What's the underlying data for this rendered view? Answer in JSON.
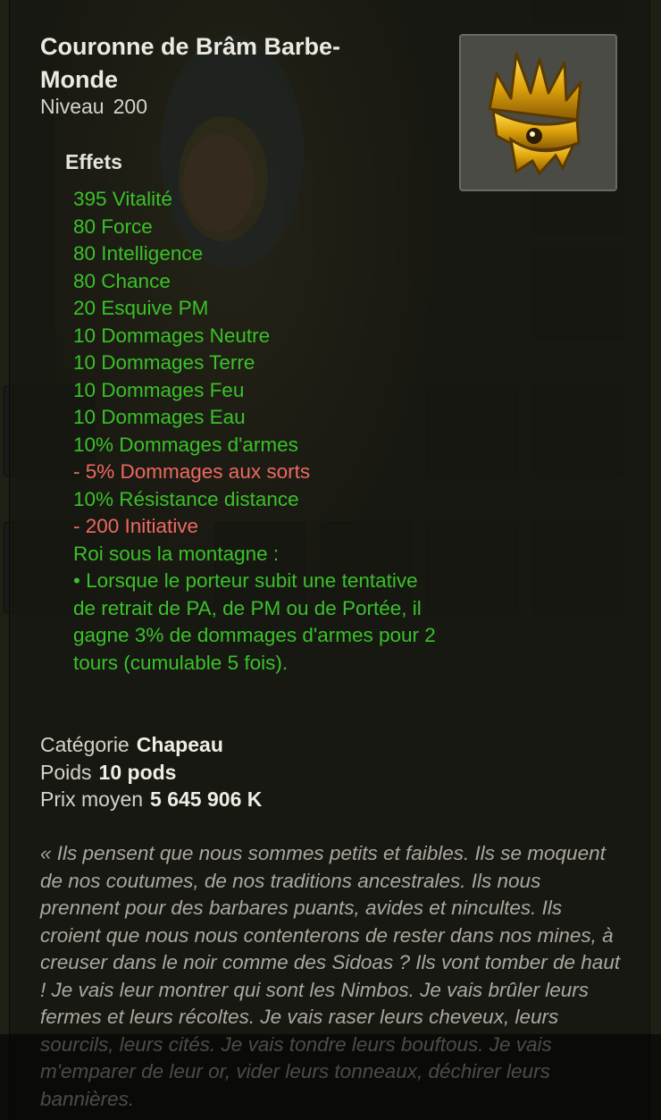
{
  "item": {
    "name": "Couronne de Brâm Barbe-Monde",
    "level_label": "Niveau",
    "level_value": "200",
    "icon": "golden-crown-icon",
    "effects_header": "Effets",
    "effects": [
      {
        "text": "395 Vitalité",
        "type": "positive"
      },
      {
        "text": "80 Force",
        "type": "positive"
      },
      {
        "text": "80 Intelligence",
        "type": "positive"
      },
      {
        "text": "80 Chance",
        "type": "positive"
      },
      {
        "text": "20 Esquive PM",
        "type": "positive"
      },
      {
        "text": "10 Dommages Neutre",
        "type": "positive"
      },
      {
        "text": "10 Dommages Terre",
        "type": "positive"
      },
      {
        "text": "10 Dommages Feu",
        "type": "positive"
      },
      {
        "text": "10 Dommages Eau",
        "type": "positive"
      },
      {
        "text": "10% Dommages d'armes",
        "type": "positive"
      },
      {
        "text": "- 5% Dommages aux sorts",
        "type": "negative"
      },
      {
        "text": "10% Résistance distance",
        "type": "positive"
      },
      {
        "text": "- 200 Initiative",
        "type": "negative"
      },
      {
        "text": "Roi sous la montagne :",
        "type": "positive"
      }
    ],
    "special_effect": "• Lorsque le porteur subit une tentative de retrait de PA, de PM ou de Portée, il gagne 3% de dommages d'armes pour 2 tours (cumulable 5 fois).",
    "properties": {
      "category_label": "Catégorie",
      "category_value": "Chapeau",
      "weight_label": "Poids",
      "weight_value": "10 pods",
      "price_label": "Prix moyen",
      "price_value": "5 645 906 K"
    },
    "lore": "« Ils pensent que nous sommes petits et faibles. Ils se moquent de nos coutumes, de nos traditions ancestrales. Ils nous prennent pour des barbares puants, avides et nincultes. Ils croient que nous nous contenterons de rester dans nos mines, à creuser dans le noir comme des Sidoas ? Ils vont tomber de haut ! Je vais leur montrer qui sont les Nimbos. Je vais brûler leurs fermes et leurs récoltes. Je vais raser leurs cheveux, leurs sourcils, leurs cités. Je vais tondre leurs bouftous. Je vais m'emparer de leur or, vider leurs tonneaux, déchirer leurs bannières."
  },
  "colors": {
    "positive": "#3ac129",
    "negative": "#ec6a60",
    "panel": "#16161233"
  }
}
